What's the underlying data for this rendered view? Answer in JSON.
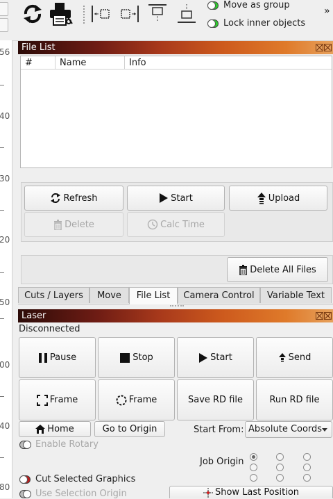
{
  "toolbar": {
    "toggle1_label": "Move as group",
    "toggle2_label": "Lock inner objects",
    "overflow": "»"
  },
  "ruler": {
    "labels": [
      "56",
      "40",
      "30",
      "20",
      "50",
      "00",
      "40",
      "80"
    ]
  },
  "file_list": {
    "title": "File List",
    "columns": [
      "#",
      "Name",
      "Info"
    ],
    "buttons": {
      "refresh": "Refresh",
      "start": "Start",
      "upload": "Upload",
      "delete": "Delete",
      "calc_time": "Calc Time",
      "delete_all": "Delete All Files"
    }
  },
  "tabs": [
    "Cuts / Layers",
    "Move",
    "File List",
    "Camera Control",
    "Variable Text"
  ],
  "active_tab": "File List",
  "laser": {
    "title": "Laser",
    "status": "Disconnected",
    "buttons": {
      "pause": "Pause",
      "stop": "Stop",
      "start": "Start",
      "send": "Send",
      "frame1": "Frame",
      "frame2": "Frame",
      "save_rd": "Save RD file",
      "run_rd": "Run RD file",
      "home": "Home",
      "go_to_origin": "Go to Origin",
      "show_last_position": "Show Last Position"
    },
    "start_from_label": "Start From:",
    "start_from_value": "Absolute Coords",
    "enable_rotary": "Enable Rotary",
    "job_origin_label": "Job Origin",
    "cut_selected": "Cut Selected Graphics",
    "use_selection_origin": "Use Selection Origin"
  }
}
